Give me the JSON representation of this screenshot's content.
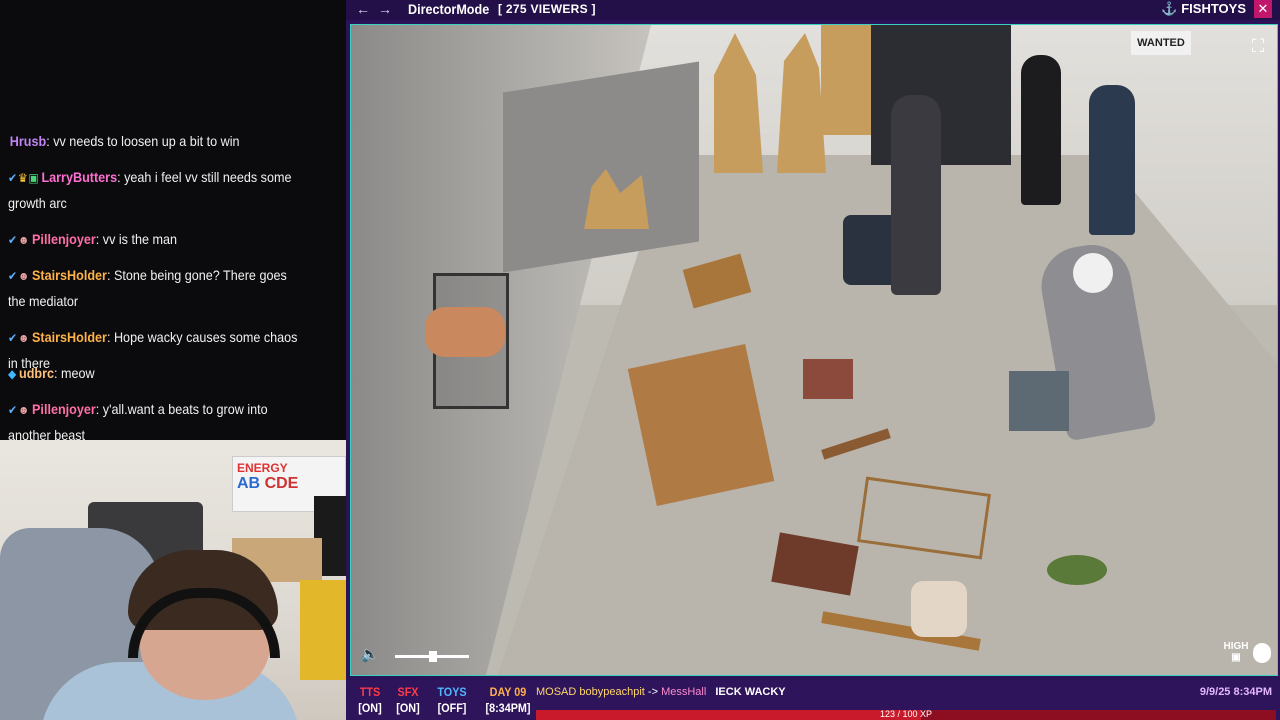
{
  "chat": {
    "messages": [
      {
        "user": "Hrusb",
        "user_color": "#c184f5",
        "text": "vv needs to loosen up a bit to win",
        "badges": []
      },
      {
        "user": "LarryButters",
        "user_color": "#ff6fd1",
        "text": "yeah i feel vv still needs some growth arc",
        "badges": [
          "sword-badge-icon",
          "crown-badge-icon",
          "gift-badge-icon"
        ]
      },
      {
        "user": "Pillenjoyer",
        "user_color": "#ff6fa8",
        "text": "vv is the man",
        "badges": [
          "sword-badge-icon",
          "bust-badge-icon"
        ]
      },
      {
        "user": "StairsHolder",
        "user_color": "#ffb24a",
        "text": "Stone being gone? There goes the mediator",
        "badges": [
          "sword-badge-icon",
          "bust-badge-icon"
        ]
      },
      {
        "user": "StairsHolder",
        "user_color": "#ffb24a",
        "text": "Hope wacky causes some chaos in there",
        "badges": [
          "sword-badge-icon",
          "bust-badge-icon"
        ]
      },
      {
        "user": "udbrc",
        "user_color": "#ffc07a",
        "text": "meow",
        "badges": [
          "gem-badge-icon"
        ]
      },
      {
        "user": "Pillenjoyer",
        "user_color": "#ff6fa8",
        "text": "y'all.want a beats to grow into another beast",
        "badges": [
          "sword-badge-icon",
          "bust-badge-icon"
        ]
      }
    ]
  },
  "webcam": {
    "sign_text": "ENERGY",
    "sign_letters": "AB",
    "sign_letters_2": "CDE"
  },
  "player": {
    "title": "DirectorMode",
    "viewers": "[ 275 VIEWERS ]",
    "brand": "FISHTOYS",
    "quality_label": "HIGH",
    "wanted_sign": "WANTED"
  },
  "status": {
    "tts_label": "TTS",
    "tts_value": "[ON]",
    "sfx_label": "SFX",
    "sfx_value": "[ON]",
    "toys_label": "TOYS",
    "toys_value": "[OFF]",
    "day_label": "DAY 09",
    "day_value": "[8:34PM]",
    "ticker_from": "MOSAD bobypeachpit",
    "ticker_arrow": "->",
    "ticker_to": "MessHall",
    "ticker_msg": "IECK WACKY",
    "clock": "9/9/25 8:34PM",
    "progress_text": "123 / 100 XP",
    "progress_fraction": 0.52,
    "colors": {
      "tts": "#ff3b4a",
      "sfx": "#ff3b4a",
      "toys": "#4fb8ff",
      "day": "#ffb24a",
      "brand_accent": "#3cd0c0"
    }
  }
}
